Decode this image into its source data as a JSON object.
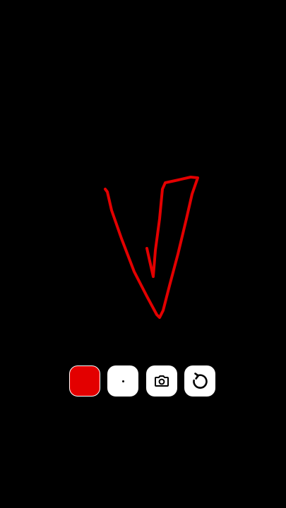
{
  "canvas": {
    "background_color": "#000000",
    "stroke_color": "#e30000"
  },
  "toolbar": {
    "items": [
      {
        "name": "color-swatch",
        "icon": "color-swatch",
        "color": "#e30000"
      },
      {
        "name": "brush-size",
        "icon": "dot-icon",
        "color": "#ffffff"
      },
      {
        "name": "capture",
        "icon": "camera-icon",
        "color": "#ffffff"
      },
      {
        "name": "reset",
        "icon": "rotate-ccw-icon",
        "color": "#ffffff"
      }
    ]
  }
}
